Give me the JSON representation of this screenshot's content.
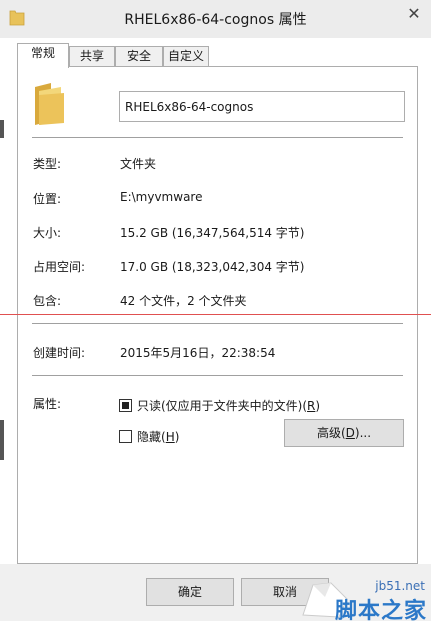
{
  "window": {
    "title": "RHEL6x86-64-cognos 属性",
    "close_glyph": "✕"
  },
  "tabs": [
    {
      "label": "常规",
      "active": true
    },
    {
      "label": "共享",
      "active": false
    },
    {
      "label": "安全",
      "active": false
    },
    {
      "label": "自定义",
      "active": false
    }
  ],
  "general": {
    "folder_name": "RHEL6x86-64-cognos",
    "type_label": "类型:",
    "type_value": "文件夹",
    "location_label": "位置:",
    "location_value": "E:\\myvmware",
    "size_label": "大小:",
    "size_value": "15.2 GB (16,347,564,514 字节)",
    "size_on_disk_label": "占用空间:",
    "size_on_disk_value": "17.0 GB (18,323,042,304 字节)",
    "contains_label": "包含:",
    "contains_value": "42 个文件，2 个文件夹",
    "created_label": "创建时间:",
    "created_value": "2015年5月16日，22:38:54",
    "attributes_label": "属性:",
    "readonly": {
      "text": "只读(仅应用于文件夹中的文件)(",
      "key": "R",
      "close": ")",
      "checked": true
    },
    "hidden": {
      "text": "隐藏(",
      "key": "H",
      "close": ")",
      "checked": false
    },
    "advanced": {
      "text": "高级(",
      "key": "D",
      "close": ")..."
    }
  },
  "footer": {
    "ok_label": "确定",
    "cancel_label": "取消"
  },
  "watermark": {
    "url": "jb51.net",
    "text": "脚本之家"
  },
  "colors": {
    "folder_yellow": "#e8c25a",
    "divider": "#a0a0a0",
    "accent_line": "#e05050"
  }
}
